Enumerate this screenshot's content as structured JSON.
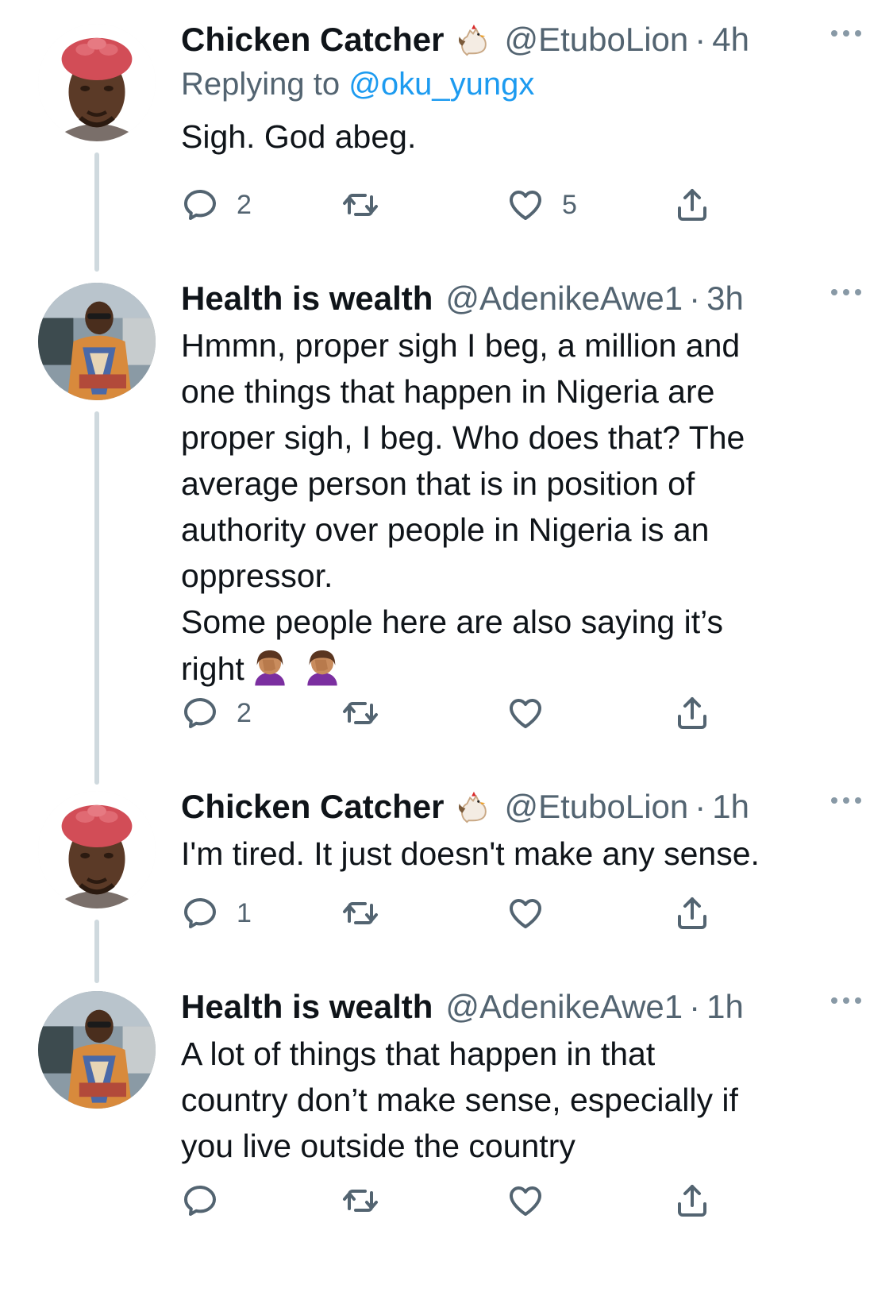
{
  "tweets": [
    {
      "name": "Chicken Catcher",
      "handle": "@EtuboLion",
      "separator": "·",
      "time": "4h",
      "replying_label": "Replying to",
      "replying_to": "@oku_yungx",
      "text": "Sigh. God abeg.",
      "avatar": "man-red-headwrap-avatar",
      "name_emoji": "rooster-icon",
      "counts": {
        "reply": "2",
        "retweet": "",
        "like": "5"
      }
    },
    {
      "name": "Health is wealth",
      "handle": "@AdenikeAwe1",
      "separator": "·",
      "time": "3h",
      "text": "Hmmn, proper sigh I beg, a million and\none things that happen in Nigeria are\nproper sigh, I beg. Who does that? The\naverage person that is in position of\nauthority over people in Nigeria is an\noppressor.\nSome people here are also saying it’s\nright",
      "trailing_emoji": "face-palm-icon",
      "avatar": "woman-sunglasses-avatar",
      "counts": {
        "reply": "2",
        "retweet": "",
        "like": ""
      }
    },
    {
      "name": "Chicken Catcher",
      "handle": "@EtuboLion",
      "separator": "·",
      "time": "1h",
      "text": "I'm tired. It just doesn't make any sense.",
      "avatar": "man-red-headwrap-avatar",
      "name_emoji": "rooster-icon",
      "counts": {
        "reply": "1",
        "retweet": "",
        "like": ""
      }
    },
    {
      "name": "Health is wealth",
      "handle": "@AdenikeAwe1",
      "separator": "·",
      "time": "1h",
      "text": "A lot of things that happen in that\ncountry don’t make sense, especially if\nyou live outside the country",
      "avatar": "woman-sunglasses-avatar",
      "counts": {
        "reply": "",
        "retweet": "",
        "like": ""
      }
    }
  ],
  "colors": {
    "text": "#0f1419",
    "secondary": "#536471",
    "link": "#1d9bf0",
    "thread_line": "#cfd9de"
  },
  "icons": [
    "reply-icon",
    "retweet-icon",
    "like-icon",
    "share-icon",
    "more-icon"
  ]
}
